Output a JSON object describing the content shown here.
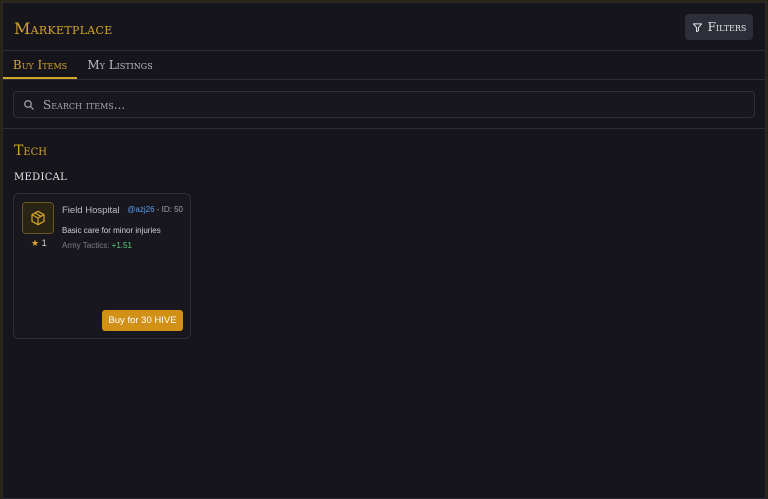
{
  "header": {
    "title": "Marketplace",
    "filters_label": "Filters"
  },
  "tabs": [
    {
      "label": "Buy Items",
      "active": true
    },
    {
      "label": "My Listings",
      "active": false
    }
  ],
  "search": {
    "placeholder": "Search items...",
    "value": ""
  },
  "section": {
    "title": "Tech",
    "subcategory": "MEDICAL"
  },
  "items": [
    {
      "name": "Field Hospital",
      "owner": "@azj26",
      "id_label": "- ID: 50",
      "rating": "1",
      "description": "Basic care for minor injuries",
      "stat_label": "Army Tactics:",
      "stat_value": "+1.51",
      "buy_label": "Buy for 30 HIVE",
      "icon": "box-icon"
    }
  ],
  "colors": {
    "accent": "#d4a52c",
    "button": "#d19117",
    "owner_link": "#5c9df0",
    "stat_positive": "#5bcf7d"
  }
}
